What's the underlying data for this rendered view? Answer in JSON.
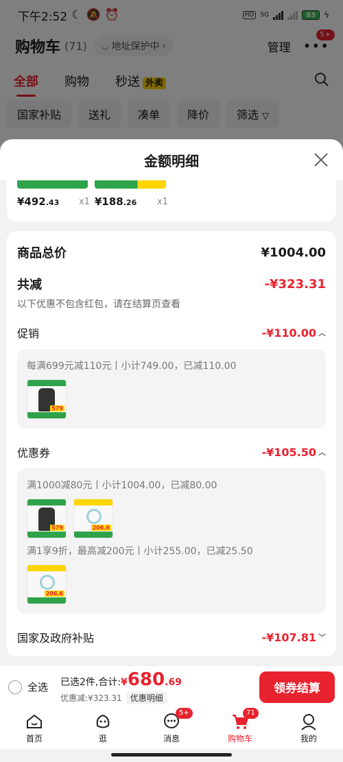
{
  "status_bar": {
    "time": "下午2:52",
    "battery": "83",
    "network": "5G",
    "hd": "HD"
  },
  "header": {
    "title": "购物车",
    "count": "(71)",
    "address_pill": "地址保护中",
    "manage": "管理",
    "more_badge": "5+"
  },
  "tabs": [
    {
      "label": "全部",
      "active": true
    },
    {
      "label": "购物",
      "active": false
    },
    {
      "label": "秒送",
      "active": false,
      "tag": "外卖"
    }
  ],
  "filters": [
    "国家补贴",
    "送礼",
    "凑单",
    "降价",
    "筛选"
  ],
  "sheet": {
    "title": "金额明细",
    "items": [
      {
        "price_int": "¥492",
        "price_dec": ".43",
        "qty": "x1"
      },
      {
        "price_int": "¥188",
        "price_dec": ".26",
        "qty": "x1"
      }
    ],
    "total_label": "商品总价",
    "total_value": "¥1004.00",
    "discount_label": "共减",
    "discount_value": "-¥323.31",
    "discount_note": "以下优惠不包含红包，请在结算页查看",
    "promo": {
      "label": "促销",
      "value": "-¥110.00",
      "line": "每满699元减110元丨小计749.00，已减110.00"
    },
    "coupon": {
      "label": "优惠券",
      "value": "-¥105.50",
      "line1": "满1000减80元丨小计1004.00，已减80.00",
      "line2": "满1享9折，最高减200元丨小计255.00，已减25.50"
    },
    "subsidy": {
      "label": "国家及政府补贴",
      "value": "-¥107.81"
    },
    "thumb_tags": {
      "a": "579",
      "b": "206.6"
    }
  },
  "checkout": {
    "select_all": "全选",
    "selected_text": "已选2件,合计:",
    "currency": "¥",
    "total_int": "680",
    "total_dec": ".69",
    "saved": "优惠减:¥323.31",
    "detail_chip": "优惠明细",
    "pay_button": "领券结算"
  },
  "tabbar": [
    {
      "label": "首页",
      "icon": "home-icon"
    },
    {
      "label": "逛",
      "icon": "browse-icon"
    },
    {
      "label": "消息",
      "icon": "message-icon",
      "badge": "5+"
    },
    {
      "label": "购物车",
      "icon": "cart-icon",
      "badge": "71",
      "active": true
    },
    {
      "label": "我的",
      "icon": "profile-icon"
    }
  ],
  "colors": {
    "accent": "#e8232f",
    "promo_green": "#2fa34a",
    "tag_yellow": "#ffd500"
  }
}
